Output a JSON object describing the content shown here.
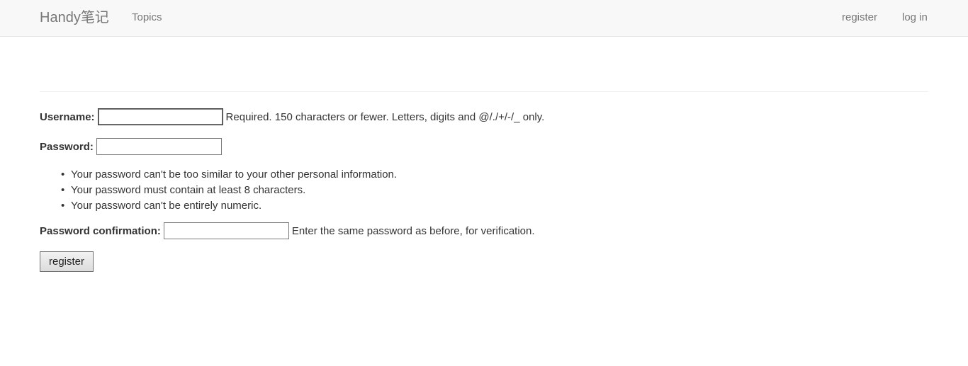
{
  "navbar": {
    "brand": "Handy笔记",
    "left_links": [
      {
        "label": "Topics"
      }
    ],
    "right_links": [
      {
        "label": "register"
      },
      {
        "label": "log in"
      }
    ]
  },
  "form": {
    "username": {
      "label": "Username:",
      "value": "",
      "help": "Required. 150 characters or fewer. Letters, digits and @/./+/-/_ only."
    },
    "password": {
      "label": "Password:",
      "value": "",
      "rules": [
        "Your password can't be too similar to your other personal information.",
        "Your password must contain at least 8 characters.",
        "Your password can't be entirely numeric."
      ]
    },
    "password_confirmation": {
      "label": "Password confirmation:",
      "value": "",
      "help": "Enter the same password as before, for verification."
    },
    "submit_label": "register"
  },
  "colors": {
    "navbar_bg": "#f8f8f8",
    "nav_text": "#777777",
    "body_text": "#333333"
  }
}
